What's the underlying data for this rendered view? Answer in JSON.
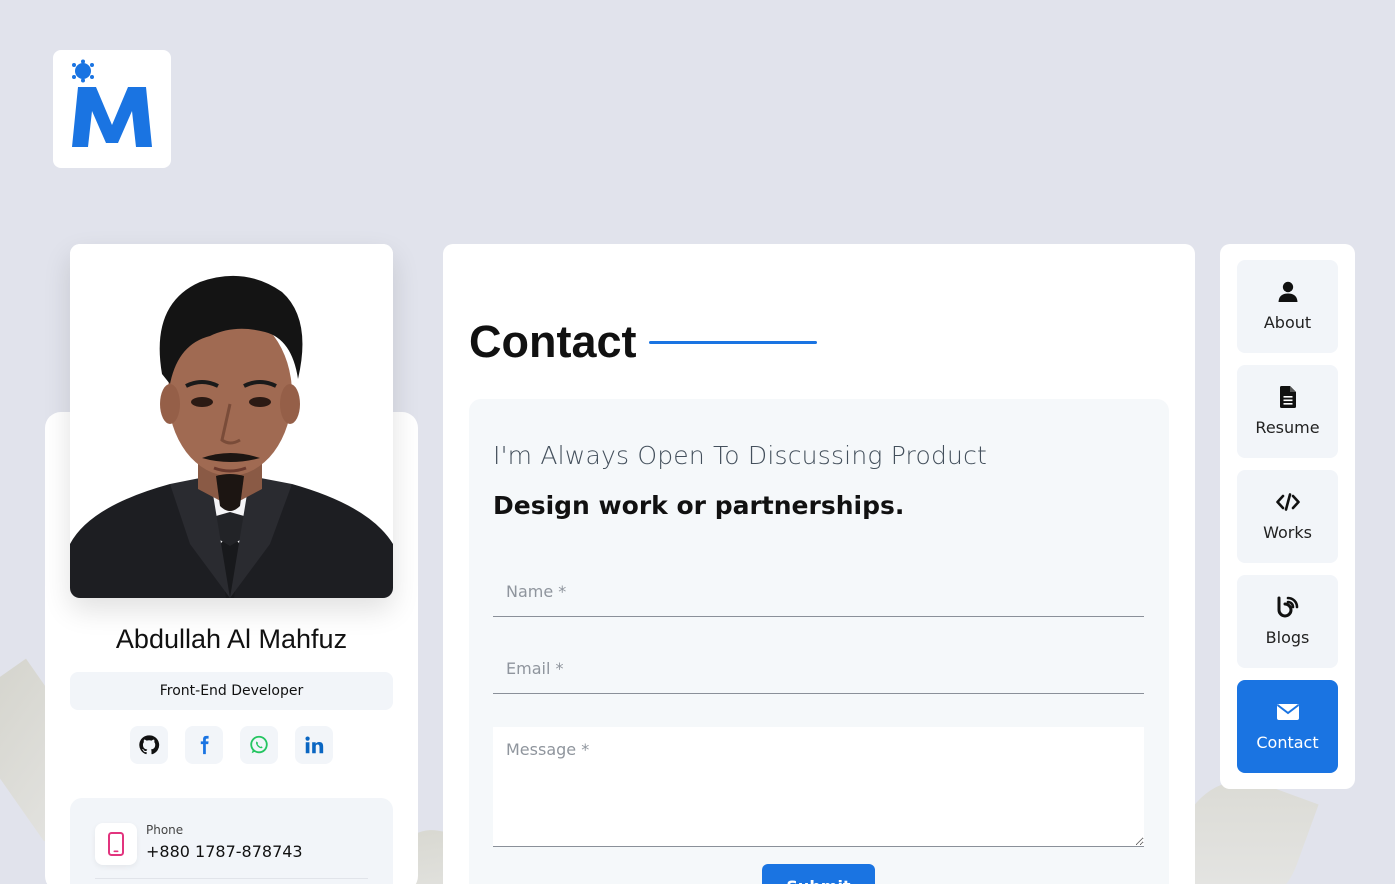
{
  "profile": {
    "name": "Abdullah Al Mahfuz",
    "role": "Front-End Developer",
    "socials": [
      "github-icon",
      "facebook-icon",
      "whatsapp-icon",
      "linkedin-icon"
    ],
    "phone_label": "Phone",
    "phone_value": "+880 1787-878743"
  },
  "main": {
    "title": "Contact",
    "tagline": "I'm Always Open To Discussing Product",
    "tagline_bold": "Design work or partnerships.",
    "form": {
      "name_placeholder": "Name *",
      "email_placeholder": "Email *",
      "message_placeholder": "Message *",
      "submit_label": "Submit"
    }
  },
  "nav": {
    "items": [
      {
        "label": "About",
        "icon": "user-icon",
        "active": false
      },
      {
        "label": "Resume",
        "icon": "file-icon",
        "active": false
      },
      {
        "label": "Works",
        "icon": "code-icon",
        "active": false
      },
      {
        "label": "Blogs",
        "icon": "blog-icon",
        "active": false
      },
      {
        "label": "Contact",
        "icon": "envelope-icon",
        "active": true
      }
    ]
  },
  "colors": {
    "accent": "#1a74e2",
    "background": "#e1e3ec",
    "panel": "#ffffff",
    "soft": "#f2f5f9",
    "phone_icon": "#e2347e"
  }
}
